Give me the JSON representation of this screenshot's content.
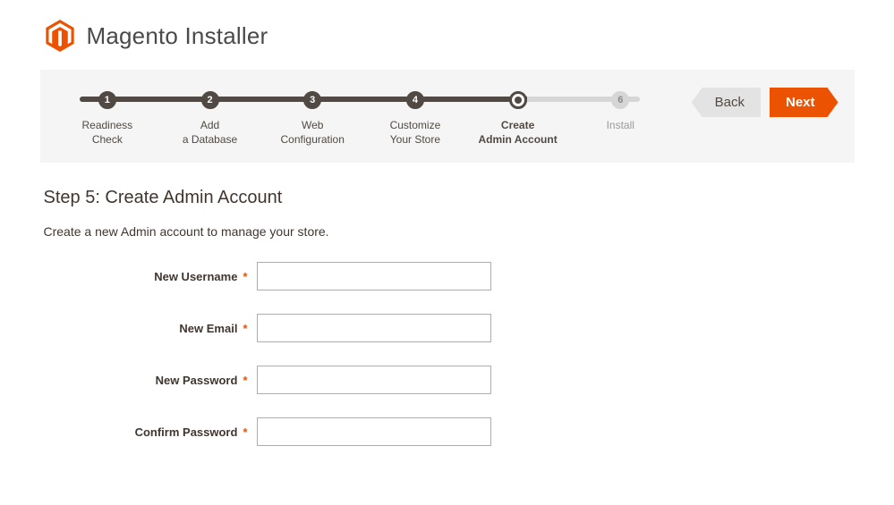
{
  "header": {
    "title": "Magento Installer"
  },
  "progress": {
    "percent_complete": 80,
    "steps": [
      {
        "num": "1",
        "line1": "Readiness",
        "line2": "Check",
        "state": "done"
      },
      {
        "num": "2",
        "line1": "Add",
        "line2": "a Database",
        "state": "done"
      },
      {
        "num": "3",
        "line1": "Web",
        "line2": "Configuration",
        "state": "done"
      },
      {
        "num": "4",
        "line1": "Customize",
        "line2": "Your Store",
        "state": "done"
      },
      {
        "num": "",
        "line1": "Create",
        "line2": "Admin Account",
        "state": "current"
      },
      {
        "num": "6",
        "line1": "Install",
        "line2": "",
        "state": "upcoming"
      }
    ]
  },
  "nav": {
    "back": "Back",
    "next": "Next"
  },
  "main": {
    "heading": "Step 5: Create Admin Account",
    "subtext": "Create a new Admin account to manage your store.",
    "fields": {
      "username": {
        "label": "New Username",
        "value": ""
      },
      "email": {
        "label": "New Email",
        "value": ""
      },
      "password": {
        "label": "New Password",
        "value": ""
      },
      "confirm": {
        "label": "Confirm Password",
        "value": ""
      }
    },
    "required_mark": "*"
  },
  "colors": {
    "accent": "#eb5202",
    "track_done": "#514943",
    "track_pending": "#d6d6d6"
  }
}
